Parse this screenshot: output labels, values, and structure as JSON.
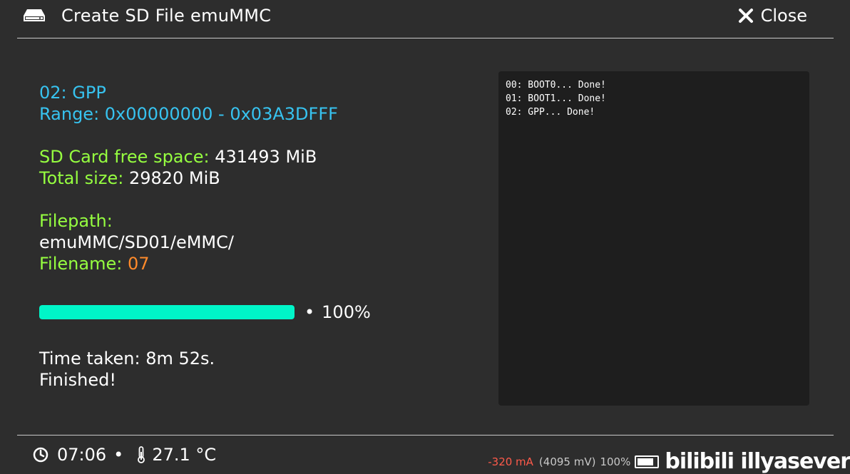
{
  "header": {
    "title": "Create SD File emuMMC",
    "close_label": "Close"
  },
  "info": {
    "partition": "02: GPP",
    "range_label": "Range: 0x00000000 - 0x03A3DFFF",
    "free_space_label": "SD Card free space:",
    "free_space_value": "431493 MiB",
    "total_size_label": "Total size:",
    "total_size_value": "29820 MiB",
    "filepath_label": "Filepath:",
    "filepath_value": "emuMMC/SD01/eMMC/",
    "filename_label": "Filename:",
    "filename_value": "07"
  },
  "progress": {
    "percent": 100,
    "percent_label": "100%"
  },
  "result": {
    "time_taken": "Time taken: 8m 52s.",
    "status": "Finished!"
  },
  "log": {
    "lines": [
      "00: BOOT0... Done!",
      "01: BOOT1... Done!",
      "02: GPP... Done!"
    ]
  },
  "footer": {
    "time": "07:06",
    "temperature": "27.1 °C",
    "current": "-320 mA",
    "voltage": "(4095 mV)",
    "battery": "100%",
    "watermark": "bilibili illyasever"
  },
  "colors": {
    "background": "#2d2d2d",
    "cyan": "#37c3f0",
    "green": "#96ff40",
    "orange": "#ff8a2a",
    "progress": "#00f5c8",
    "log_bg": "#1e1e1e"
  },
  "icons": {
    "title": "drive-icon",
    "close": "close-icon",
    "clock": "clock-icon",
    "temperature": "thermometer-icon",
    "battery": "battery-icon"
  }
}
